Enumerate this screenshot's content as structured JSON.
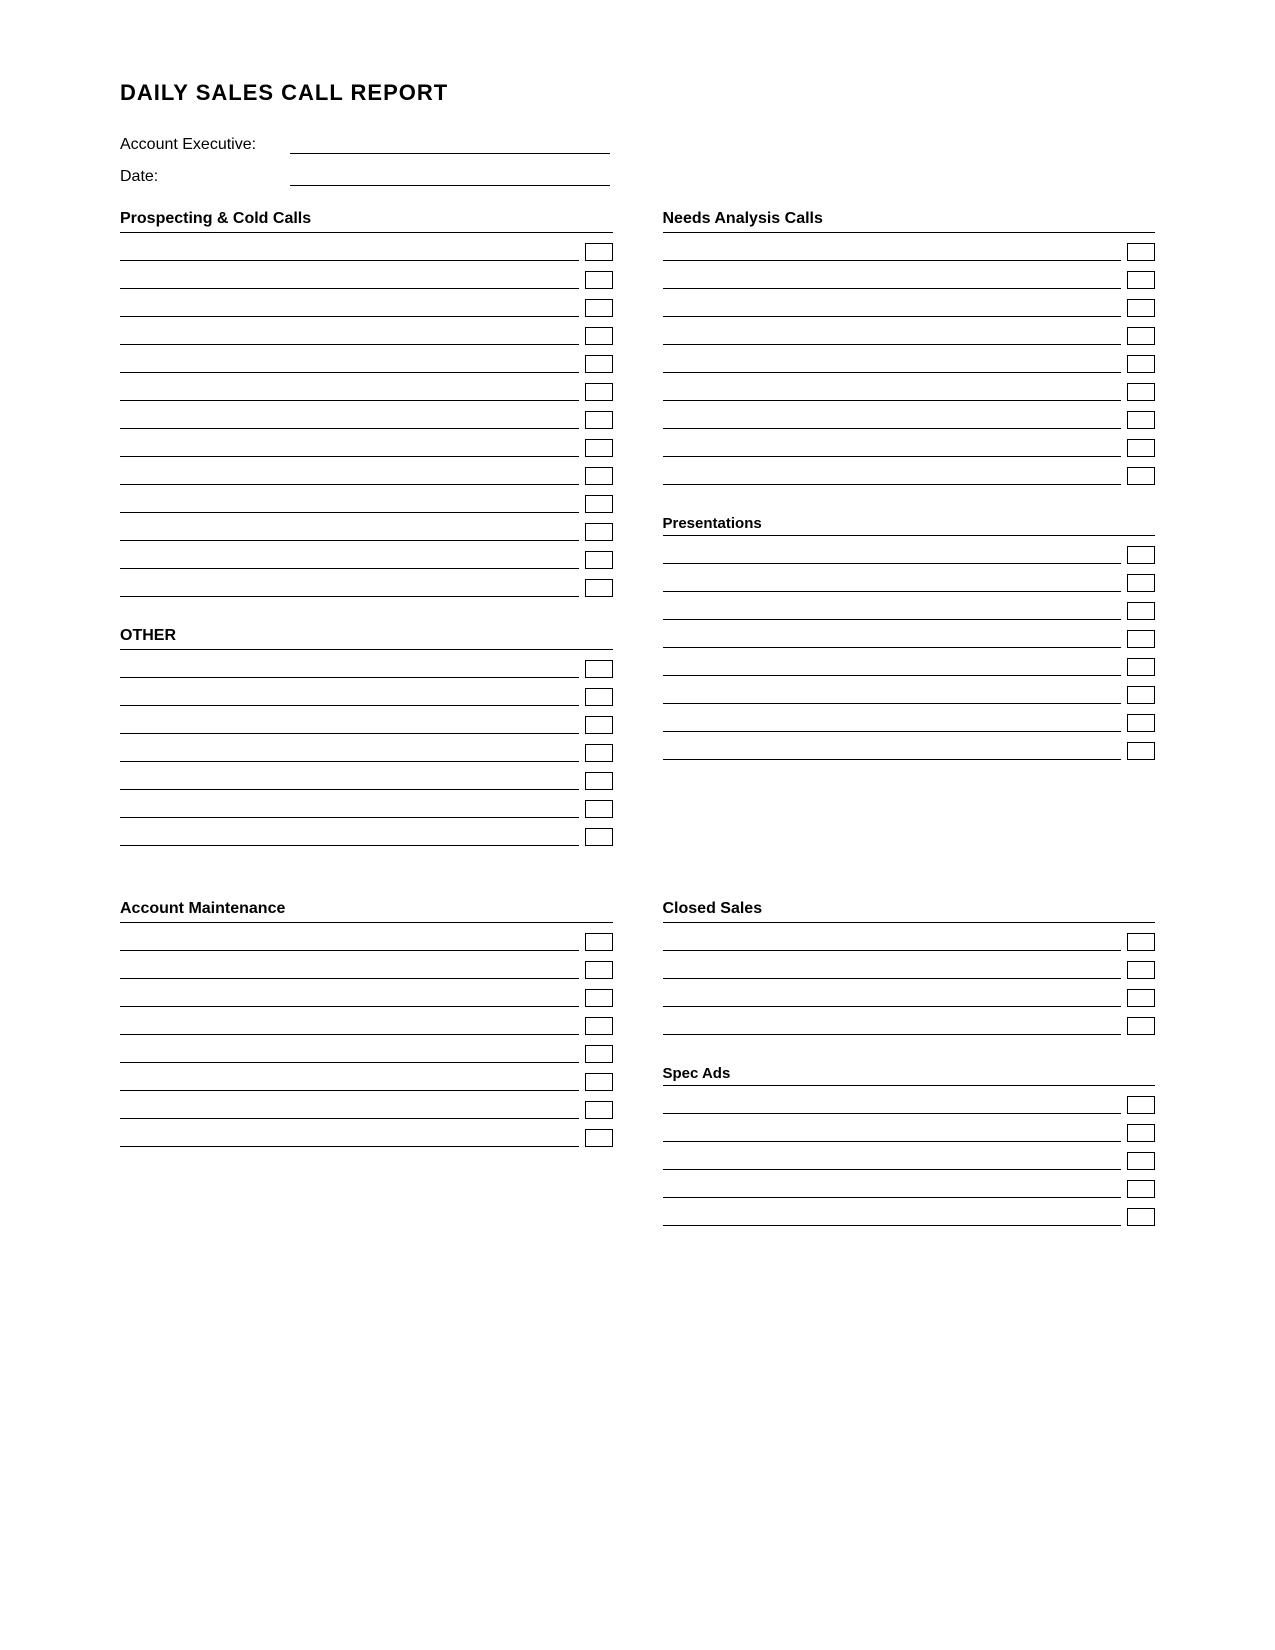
{
  "page": {
    "title": "DAILY SALES CALL REPORT",
    "fields": {
      "account_executive_label": "Account Executive:",
      "date_label": "Date:"
    },
    "sections": {
      "left_top": {
        "title": "Prospecting & Cold Calls",
        "rows": 13
      },
      "left_other": {
        "title": "OTHER",
        "rows": 7
      },
      "right_needs": {
        "title": "Needs Analysis Calls",
        "rows": 9
      },
      "right_presentations": {
        "title": "Presentations",
        "rows": 8
      },
      "left_maintenance": {
        "title": "Account Maintenance",
        "rows": 8
      },
      "right_closed": {
        "title": "Closed Sales",
        "rows": 4
      },
      "right_spec": {
        "title": "Spec Ads",
        "rows": 5
      }
    }
  }
}
